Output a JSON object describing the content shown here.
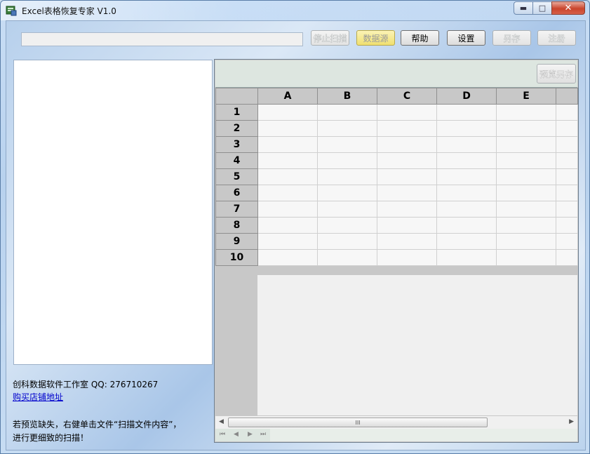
{
  "window": {
    "title": "Excel表格恢复专家 V1.0"
  },
  "toolbar": {
    "stop_scan": "停止扫描",
    "data_source": "数据源",
    "help": "帮助",
    "settings": "设置",
    "save_as": "另存",
    "register": "注册",
    "path_value": ""
  },
  "info": {
    "studio": "创科数据软件工作室 QQ: 276710267",
    "shop_link": "购买店铺地址",
    "hint_line1": "若预览缺失，右健单击文件“扫描文件内容”，",
    "hint_line2": "进行更细致的扫描！"
  },
  "preview": {
    "save_as": "预览另存"
  },
  "sheet": {
    "columns": [
      "A",
      "B",
      "C",
      "D",
      "E"
    ],
    "rows": [
      "1",
      "2",
      "3",
      "4",
      "5",
      "6",
      "7",
      "8",
      "9",
      "10"
    ]
  },
  "scroll": {
    "thumb_grip": "III"
  }
}
